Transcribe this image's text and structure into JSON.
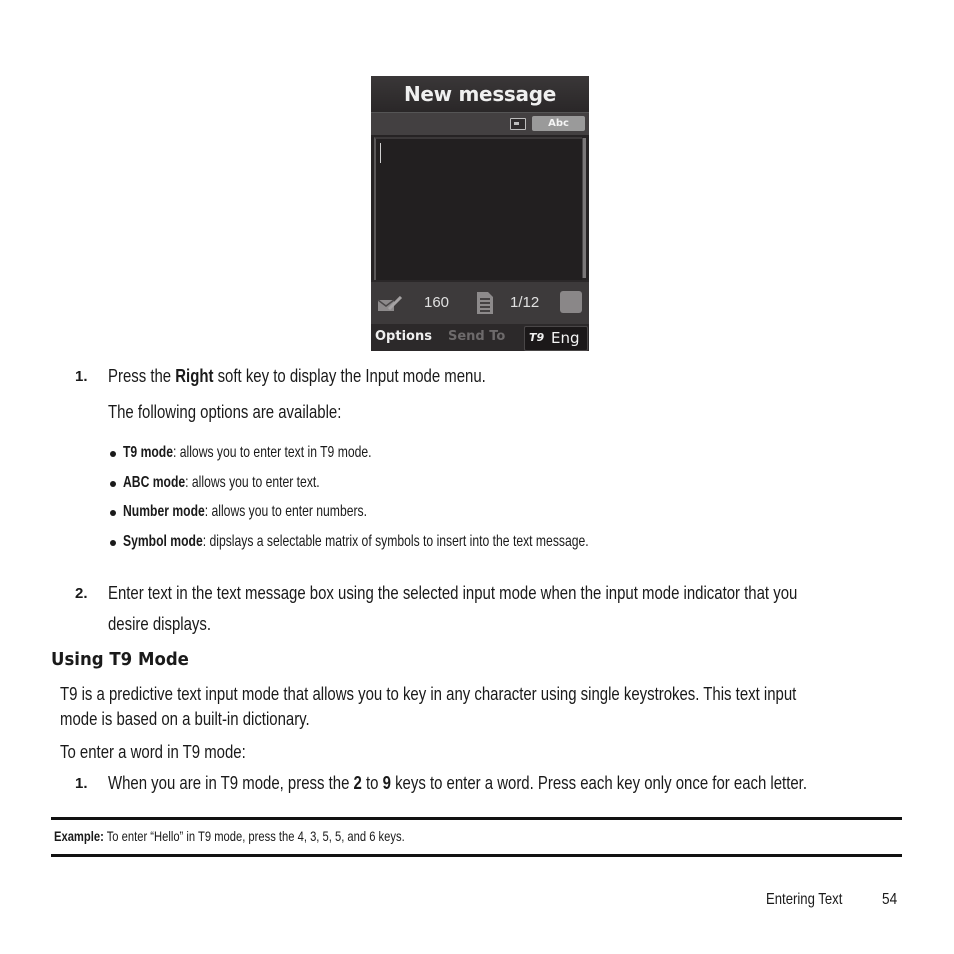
{
  "phone_screen": {
    "title": "New message",
    "input_mode_badge": "Abc",
    "char_counter": "160",
    "page_counter": "1/12",
    "softkeys": {
      "left": "Options",
      "center": "Send To",
      "right_icon": "T9",
      "right_label": "Eng"
    },
    "icons": [
      "sim-icon",
      "message-edit-icon",
      "document-icon",
      "lock-icon",
      "t9-icon"
    ]
  },
  "steps_a": [
    {
      "number": "1.",
      "text_pre": "Press the ",
      "text_bold": "Right",
      "text_post": " soft key to display the Input mode menu."
    }
  ],
  "options_intro": "The following options are available:",
  "options": [
    {
      "term": "T9 mode",
      "desc": ": allows you to enter text in T9 mode."
    },
    {
      "term": "ABC mode",
      "desc": ": allows you to enter text."
    },
    {
      "term": "Number mode",
      "desc": ": allows you to enter numbers."
    },
    {
      "term": "Symbol mode",
      "desc": ": dipslays a selectable matrix of symbols to insert into the text message."
    }
  ],
  "step2": {
    "number": "2.",
    "line1": "Enter text in the text message box using the selected input mode when the input mode indicator that you",
    "line2": "desire displays."
  },
  "section": {
    "heading": "Using T9 Mode",
    "para_line1": "T9 is a predictive text input mode that allows you to key in any character using single keystrokes. This text input",
    "para_line2": "mode is based on a built-in dictionary.",
    "intro": "To enter a word in T9 mode:",
    "step1": {
      "number": "1.",
      "pre": "When you are in T9 mode, press the ",
      "b1": "2",
      "mid": " to ",
      "b2": "9",
      "post": " keys to enter a word. Press each key only once for each letter."
    }
  },
  "example": {
    "label": "Example:",
    "text": " To enter “Hello” in T9 mode, press the 4, 3, 5, 5, and 6 keys."
  },
  "footer": {
    "section": "Entering Text",
    "page": "54"
  }
}
